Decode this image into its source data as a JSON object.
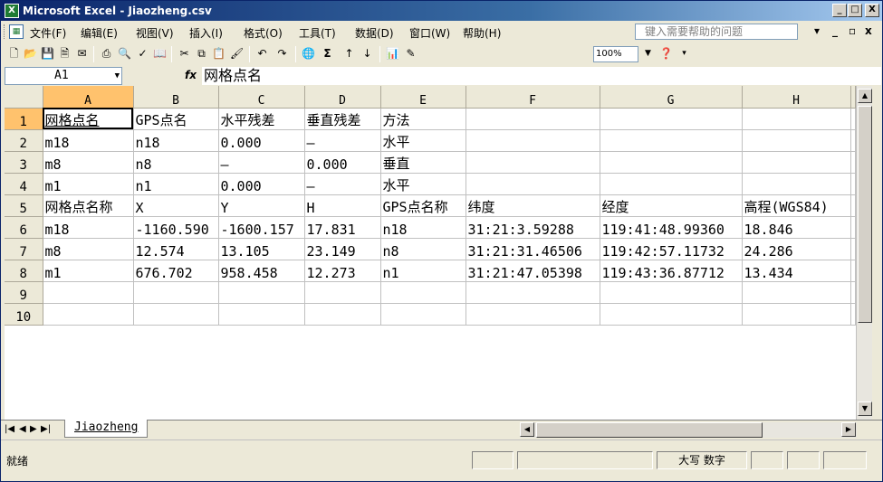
{
  "window": {
    "title": "Microsoft Excel - Jiaozheng.csv",
    "min": "_",
    "max": "□",
    "close": "X"
  },
  "menu": {
    "items": [
      "文件(F)",
      "编辑(E)",
      "视图(V)",
      "插入(I)",
      "格式(O)",
      "工具(T)",
      "数据(D)",
      "窗口(W)",
      "帮助(H)"
    ],
    "help_placeholder": "键入需要帮助的问题"
  },
  "toolbar": {
    "zoom": "100%",
    "sigma": "Σ"
  },
  "formula_bar": {
    "name_box": "A1",
    "fx": "fx",
    "formula": "网格点名"
  },
  "grid": {
    "columns": [
      "A",
      "B",
      "C",
      "D",
      "E",
      "F",
      "G",
      "H"
    ],
    "rows": [
      {
        "n": "1",
        "cells": [
          "网格点名",
          "GPS点名",
          "水平残差",
          "垂直残差",
          "方法",
          "",
          "",
          ""
        ]
      },
      {
        "n": "2",
        "cells": [
          "m18",
          "n18",
          "0.000",
          "—",
          "水平",
          "",
          "",
          ""
        ]
      },
      {
        "n": "3",
        "cells": [
          "m8",
          "n8",
          "—",
          "0.000",
          "垂直",
          "",
          "",
          ""
        ]
      },
      {
        "n": "4",
        "cells": [
          "m1",
          "n1",
          "0.000",
          "—",
          "水平",
          "",
          "",
          ""
        ]
      },
      {
        "n": "5",
        "cells": [
          "网格点名称",
          "X",
          "Y",
          "H",
          "GPS点名称",
          "纬度",
          "经度",
          "高程(WGS84)"
        ]
      },
      {
        "n": "6",
        "cells": [
          "m18",
          "-1160.590",
          "-1600.157",
          "17.831",
          "n18",
          "31:21:3.59288",
          "119:41:48.99360",
          "18.846"
        ]
      },
      {
        "n": "7",
        "cells": [
          "m8",
          "12.574",
          "13.105",
          "23.149",
          "n8",
          "31:21:31.46506",
          "119:42:57.11732",
          "24.286"
        ]
      },
      {
        "n": "8",
        "cells": [
          "m1",
          "676.702",
          "958.458",
          "12.273",
          "n1",
          "31:21:47.05398",
          "119:43:36.87712",
          "13.434"
        ]
      },
      {
        "n": "9",
        "cells": [
          "",
          "",
          "",
          "",
          "",
          "",
          "",
          ""
        ]
      },
      {
        "n": "10",
        "cells": [
          "",
          "",
          "",
          "",
          "",
          "",
          "",
          ""
        ]
      }
    ]
  },
  "sheet_tabs": [
    "Jiaozheng"
  ],
  "status": {
    "text": "就绪",
    "caps": "大写",
    "num": "数字"
  }
}
